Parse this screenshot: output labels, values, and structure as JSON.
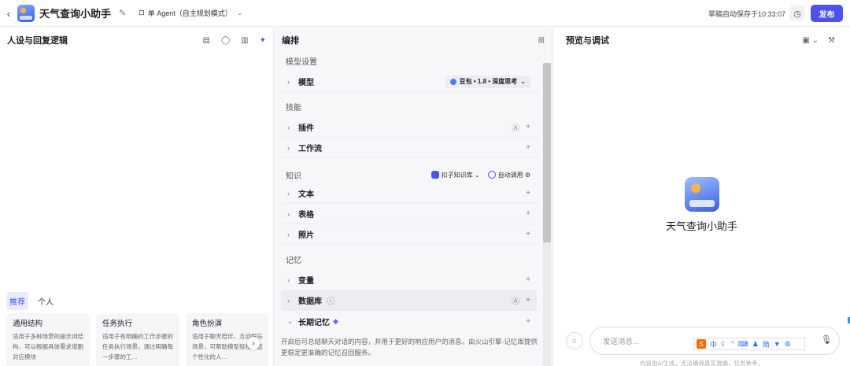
{
  "header": {
    "back_icon": "chevron-left-icon",
    "app_name": "天气查询小助手",
    "mode_label": "单 Agent（自主规划模式）",
    "autosave_text": "草稿自动保存于10:33:07",
    "publish_label": "发布"
  },
  "left_panel": {
    "title": "人设与回复逻辑",
    "tabs": [
      "推荐",
      "个人"
    ],
    "cards": [
      {
        "title": "通用结构",
        "desc": "适用于多种场景的提示词结构，可以根据具体需求增删对应模块"
      },
      {
        "title": "任务执行",
        "desc": "适用于有明确的工作步骤的任务执行场景，通过明确每一步骤的工…"
      },
      {
        "title": "角色扮演",
        "desc": "适用于聊天陪伴、互动娱乐场景，可帮助模型轻松塑造个性化的人…"
      }
    ]
  },
  "mid_panel": {
    "title": "编排",
    "model_section": "模型设置",
    "model_row_label": "模型",
    "model_value": "豆包 • 1.8 • 深度思考",
    "skills_section": "技能",
    "plugin_label": "插件",
    "workflow_label": "工作流",
    "knowledge_section": "知识",
    "kb_button": "扣子知识库",
    "auto_call": "自动调用",
    "text_label": "文本",
    "table_label": "表格",
    "photo_label": "照片",
    "memory_section": "记忆",
    "variable_label": "变量",
    "database_label": "数据库",
    "longterm_label": "长期记忆",
    "memory_desc": "开启后可总结聊天对话的内容，并用于更好的响应用户的消息。由火山引擎-记忆库提供更稳定更准确的记忆召回服务。"
  },
  "right_panel": {
    "title": "预览与调试",
    "bot_name": "天气查询小助手",
    "input_placeholder": "发送消息...",
    "ime_chars": [
      "中",
      "简"
    ],
    "disclaimer": "内容由AI生成，无法确保真实准确，仅供参考。"
  }
}
